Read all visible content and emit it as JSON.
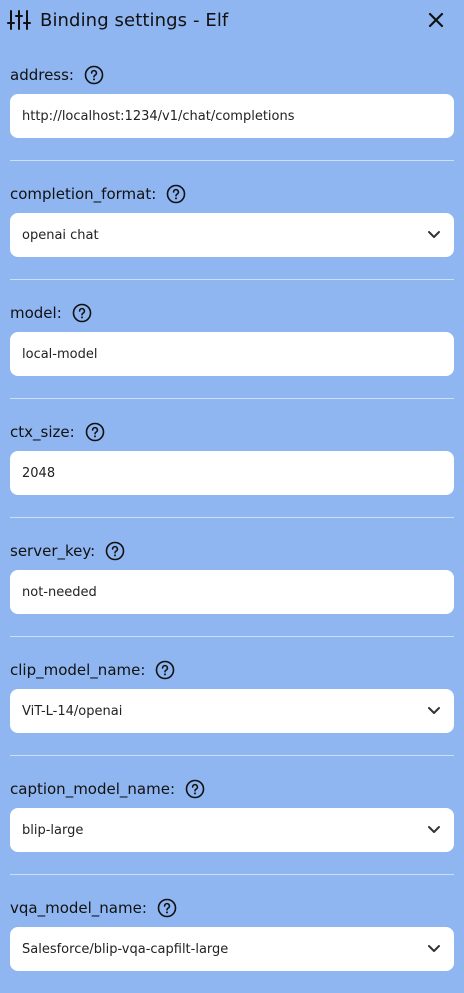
{
  "header": {
    "title": "Binding settings - Elf",
    "icons": {
      "settings": "sliders-icon",
      "close": "close-icon"
    }
  },
  "fields": [
    {
      "key": "address",
      "label": "address:",
      "type": "text",
      "value": "http://localhost:1234/v1/chat/completions"
    },
    {
      "key": "completion_format",
      "label": "completion_format:",
      "type": "select",
      "value": "openai chat"
    },
    {
      "key": "model",
      "label": "model:",
      "type": "text",
      "value": "local-model"
    },
    {
      "key": "ctx_size",
      "label": "ctx_size:",
      "type": "text",
      "value": "2048"
    },
    {
      "key": "server_key",
      "label": "server_key:",
      "type": "text",
      "value": "not-needed"
    },
    {
      "key": "clip_model_name",
      "label": "clip_model_name:",
      "type": "select",
      "value": "ViT-L-14/openai"
    },
    {
      "key": "caption_model_name",
      "label": "caption_model_name:",
      "type": "select",
      "value": "blip-large"
    },
    {
      "key": "vqa_model_name",
      "label": "vqa_model_name:",
      "type": "select",
      "value": "Salesforce/blip-vqa-capfilt-large"
    }
  ],
  "colors": {
    "background": "#8fb6f1",
    "input_bg": "#ffffff",
    "divider": "#ffffff"
  }
}
